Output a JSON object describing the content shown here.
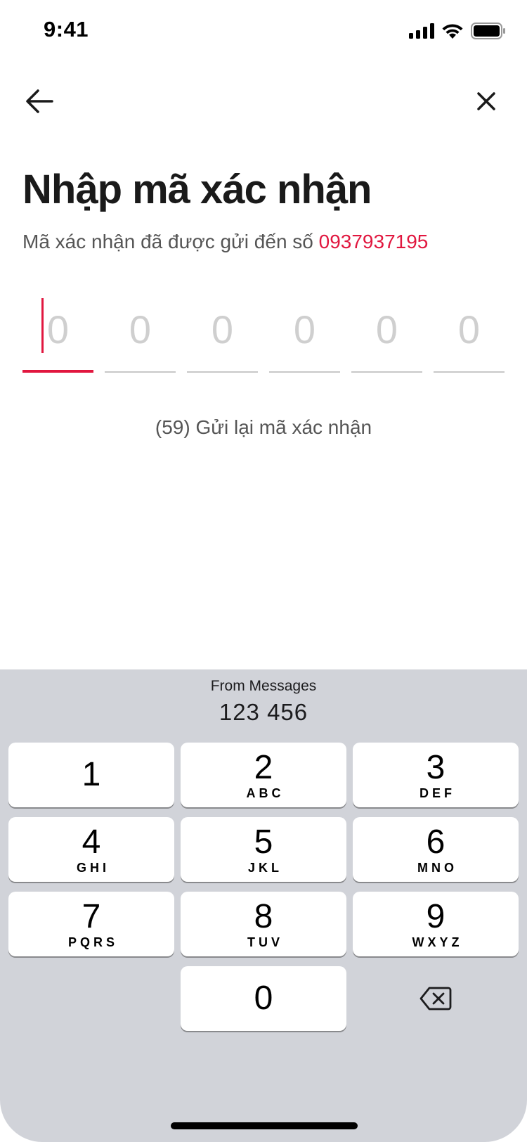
{
  "status_bar": {
    "time": "9:41"
  },
  "screen": {
    "title": "Nhập mã xác nhận",
    "subtitle_prefix": "Mã xác nhận đã được gửi đến số ",
    "phone": "0937937195",
    "otp_placeholders": [
      "0",
      "0",
      "0",
      "0",
      "0",
      "0"
    ],
    "resend_text": "(59) Gửi lại mã xác nhận",
    "accent_color": "#e1173f"
  },
  "keyboard": {
    "suggestion_label": "From Messages",
    "suggestion_code": "123 456",
    "keys": [
      {
        "num": "1",
        "letters": ""
      },
      {
        "num": "2",
        "letters": "ABC"
      },
      {
        "num": "3",
        "letters": "DEF"
      },
      {
        "num": "4",
        "letters": "GHI"
      },
      {
        "num": "5",
        "letters": "JKL"
      },
      {
        "num": "6",
        "letters": "MNO"
      },
      {
        "num": "7",
        "letters": "PQRS"
      },
      {
        "num": "8",
        "letters": "TUV"
      },
      {
        "num": "9",
        "letters": "WXYZ"
      },
      {
        "num": "0",
        "letters": ""
      }
    ],
    "background_color": "#d1d3d9"
  }
}
